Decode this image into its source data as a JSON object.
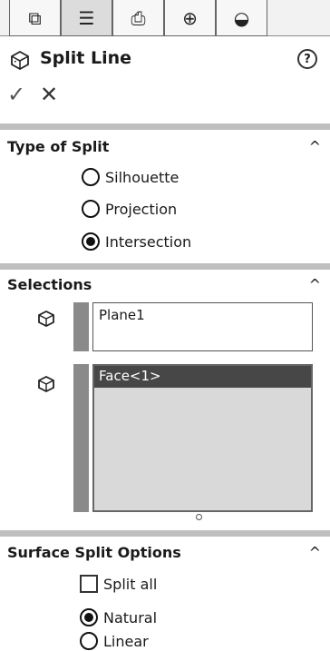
{
  "title": "Split Line",
  "tabs": [
    {
      "icon": "feature-manager-icon",
      "glyph": "⧉"
    },
    {
      "icon": "property-manager-icon",
      "glyph": "☰"
    },
    {
      "icon": "configuration-manager-icon",
      "glyph": "⎙"
    },
    {
      "icon": "dimxpert-manager-icon",
      "glyph": "⊕"
    },
    {
      "icon": "display-manager-icon",
      "glyph": "◒"
    }
  ],
  "help_glyph": "?",
  "actions": {
    "ok_glyph": "✓",
    "cancel_glyph": "✕"
  },
  "type_of_split": {
    "header": "Type of Split",
    "options": [
      {
        "label": "Silhouette",
        "checked": false
      },
      {
        "label": "Projection",
        "checked": false
      },
      {
        "label": "Intersection",
        "checked": true
      }
    ]
  },
  "selections": {
    "header": "Selections",
    "first_box": "Plane1",
    "second_list": [
      "Face<1>"
    ]
  },
  "surface_split_options": {
    "header": "Surface Split Options",
    "split_all_label": "Split all",
    "split_all_checked": false,
    "options": [
      {
        "label": "Natural",
        "checked": true
      },
      {
        "label": "Linear",
        "checked": false
      }
    ]
  },
  "chevron": "^"
}
